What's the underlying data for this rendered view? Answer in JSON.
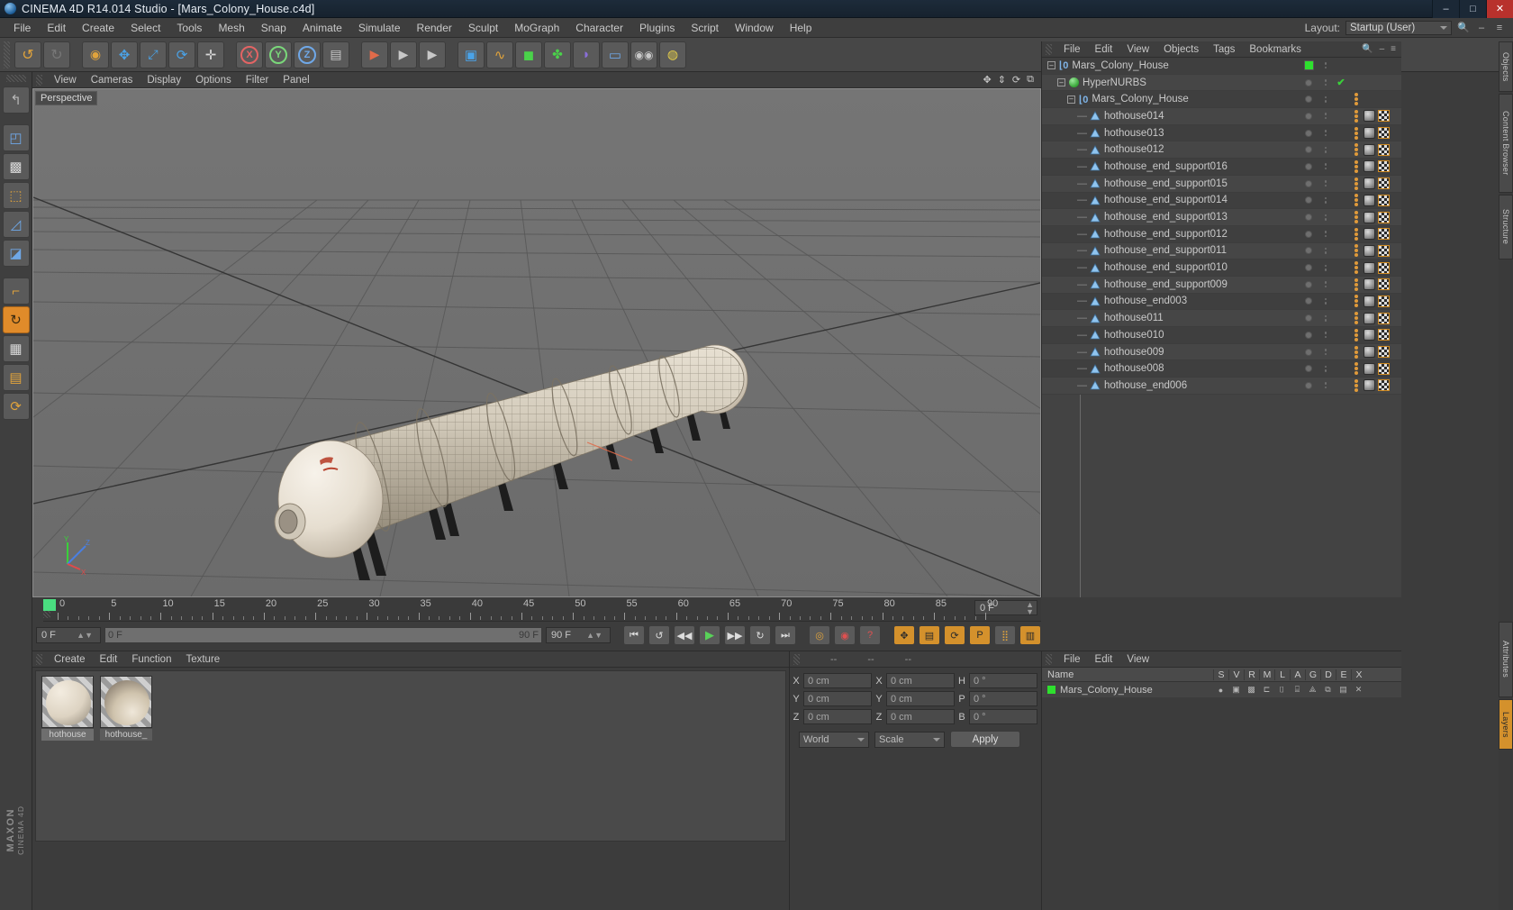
{
  "window": {
    "title": "CINEMA 4D R14.014 Studio - [Mars_Colony_House.c4d]",
    "minimize": "–",
    "maximize": "□",
    "close": "✕"
  },
  "menubar": {
    "items": [
      "File",
      "Edit",
      "Create",
      "Select",
      "Tools",
      "Mesh",
      "Snap",
      "Animate",
      "Simulate",
      "Render",
      "Sculpt",
      "MoGraph",
      "Character",
      "Plugins",
      "Script",
      "Window",
      "Help"
    ],
    "layout_label": "Layout:",
    "layout_value": "Startup (User)",
    "search_icon": "search-icon",
    "minus_icon": "–",
    "menu_icon": "≡"
  },
  "toolbar": {
    "buttons": [
      {
        "name": "undo-button",
        "glyph": "↺"
      },
      {
        "name": "redo-button",
        "glyph": "↻"
      },
      {
        "name": "live-selection-button",
        "glyph": "◉"
      },
      {
        "name": "move-button",
        "glyph": "✥"
      },
      {
        "name": "scale-button",
        "glyph": "⤡"
      },
      {
        "name": "rotate-button",
        "glyph": "⟳"
      },
      {
        "name": "world-object-axis-button",
        "glyph": "✛"
      },
      {
        "name": "lock-x-axis-button",
        "glyph": "X"
      },
      {
        "name": "lock-y-axis-button",
        "glyph": "Y"
      },
      {
        "name": "lock-z-axis-button",
        "glyph": "Z"
      },
      {
        "name": "world-coordinates-button",
        "glyph": "⬓"
      },
      {
        "name": "render-view-button",
        "glyph": "▶"
      },
      {
        "name": "render-region-button",
        "glyph": "▶"
      },
      {
        "name": "render-settings-button",
        "glyph": "▶"
      },
      {
        "name": "cube-primitive-button",
        "glyph": "▣"
      },
      {
        "name": "spline-button",
        "glyph": "〜"
      },
      {
        "name": "hypernurbs-button",
        "glyph": "◼"
      },
      {
        "name": "array-button",
        "glyph": "✤"
      },
      {
        "name": "bend-deformer-button",
        "glyph": "◗"
      },
      {
        "name": "floor-button",
        "glyph": "▭"
      },
      {
        "name": "camera-button",
        "glyph": "◉◉"
      },
      {
        "name": "light-button",
        "glyph": "💡"
      }
    ]
  },
  "left_palette": {
    "buttons": [
      {
        "name": "tool-undo-view-button",
        "glyph": "↰"
      },
      {
        "name": "tool-model-mode-button",
        "glyph": "◰"
      },
      {
        "name": "tool-texture-mode-button",
        "glyph": "▩"
      },
      {
        "name": "tool-points-mode-button",
        "glyph": "⬚"
      },
      {
        "name": "tool-edges-mode-button",
        "glyph": "◿"
      },
      {
        "name": "tool-polygons-mode-button",
        "glyph": "◪"
      },
      {
        "name": "tool-axis-mode-button",
        "glyph": "⌐"
      },
      {
        "name": "tool-enable-axis-button",
        "glyph": "↻"
      },
      {
        "name": "tool-viewport-solo-button",
        "glyph": "▦"
      },
      {
        "name": "tool-lock-button",
        "glyph": "🔒"
      },
      {
        "name": "tool-quantize-button",
        "glyph": "⟳"
      }
    ],
    "brand": "MAXON",
    "brand_sub": "CINEMA 4D"
  },
  "viewport": {
    "menus": [
      "View",
      "Cameras",
      "Display",
      "Options",
      "Filter",
      "Panel"
    ],
    "label": "Perspective",
    "axis": {
      "x": "X",
      "y": "Y",
      "z": "Z"
    },
    "corner_icons": [
      "pan-icon",
      "dolly-icon",
      "rotate-icon",
      "maximize-icon"
    ]
  },
  "object_manager": {
    "menus": [
      "File",
      "Edit",
      "View",
      "Objects",
      "Tags",
      "Bookmarks"
    ],
    "right_icons": [
      "search-icon",
      "minimize-icon",
      "menu-icon"
    ],
    "rows": [
      {
        "label": "Mars_Colony_House",
        "indent": 0,
        "icon": "null-object-icon",
        "expander": "–",
        "visdot": "green",
        "tags": []
      },
      {
        "label": "HyperNURBS",
        "indent": 1,
        "icon": "hypernurbs-icon",
        "expander": "–",
        "visdot": "gray",
        "check": "✔",
        "tags": []
      },
      {
        "label": "Mars_Colony_House",
        "indent": 2,
        "icon": "null-object-icon",
        "expander": "–",
        "visdot": "gray",
        "tags": []
      },
      {
        "label": "hothouse014",
        "indent": 3,
        "icon": "polygon-object-icon",
        "expander": "",
        "visdot": "gray",
        "tags": [
          "material",
          "texture"
        ]
      },
      {
        "label": "hothouse013",
        "indent": 3,
        "icon": "polygon-object-icon",
        "expander": "",
        "visdot": "gray",
        "tags": [
          "material",
          "texture"
        ]
      },
      {
        "label": "hothouse012",
        "indent": 3,
        "icon": "polygon-object-icon",
        "expander": "",
        "visdot": "gray",
        "tags": [
          "material",
          "texture"
        ]
      },
      {
        "label": "hothouse_end_support016",
        "indent": 3,
        "icon": "polygon-object-icon",
        "expander": "",
        "visdot": "gray",
        "tags": [
          "material",
          "texture"
        ]
      },
      {
        "label": "hothouse_end_support015",
        "indent": 3,
        "icon": "polygon-object-icon",
        "expander": "",
        "visdot": "gray",
        "tags": [
          "material",
          "texture"
        ]
      },
      {
        "label": "hothouse_end_support014",
        "indent": 3,
        "icon": "polygon-object-icon",
        "expander": "",
        "visdot": "gray",
        "tags": [
          "material",
          "texture"
        ]
      },
      {
        "label": "hothouse_end_support013",
        "indent": 3,
        "icon": "polygon-object-icon",
        "expander": "",
        "visdot": "gray",
        "tags": [
          "material",
          "texture"
        ]
      },
      {
        "label": "hothouse_end_support012",
        "indent": 3,
        "icon": "polygon-object-icon",
        "expander": "",
        "visdot": "gray",
        "tags": [
          "material",
          "texture"
        ]
      },
      {
        "label": "hothouse_end_support011",
        "indent": 3,
        "icon": "polygon-object-icon",
        "expander": "",
        "visdot": "gray",
        "tags": [
          "material",
          "texture"
        ]
      },
      {
        "label": "hothouse_end_support010",
        "indent": 3,
        "icon": "polygon-object-icon",
        "expander": "",
        "visdot": "gray",
        "tags": [
          "material",
          "texture"
        ]
      },
      {
        "label": "hothouse_end_support009",
        "indent": 3,
        "icon": "polygon-object-icon",
        "expander": "",
        "visdot": "gray",
        "tags": [
          "material",
          "texture"
        ]
      },
      {
        "label": "hothouse_end003",
        "indent": 3,
        "icon": "polygon-object-icon",
        "expander": "",
        "visdot": "gray",
        "tags": [
          "material",
          "texture"
        ]
      },
      {
        "label": "hothouse011",
        "indent": 3,
        "icon": "polygon-object-icon",
        "expander": "",
        "visdot": "gray",
        "tags": [
          "material",
          "texture"
        ]
      },
      {
        "label": "hothouse010",
        "indent": 3,
        "icon": "polygon-object-icon",
        "expander": "",
        "visdot": "gray",
        "tags": [
          "material",
          "texture"
        ]
      },
      {
        "label": "hothouse009",
        "indent": 3,
        "icon": "polygon-object-icon",
        "expander": "",
        "visdot": "gray",
        "tags": [
          "material",
          "texture"
        ]
      },
      {
        "label": "hothouse008",
        "indent": 3,
        "icon": "polygon-object-icon",
        "expander": "",
        "visdot": "gray",
        "tags": [
          "material",
          "texture"
        ]
      },
      {
        "label": "hothouse_end006",
        "indent": 3,
        "icon": "polygon-object-icon",
        "expander": "",
        "visdot": "gray",
        "tags": [
          "material",
          "texture"
        ]
      }
    ]
  },
  "right_dock": {
    "tabs": [
      "Objects",
      "Content Browser",
      "Structure",
      "Attributes",
      "Layers"
    ],
    "active_tab": "Layers"
  },
  "timeline": {
    "ticks": [
      0,
      5,
      10,
      15,
      20,
      25,
      30,
      35,
      40,
      45,
      50,
      55,
      60,
      65,
      70,
      75,
      80,
      85,
      90
    ],
    "current_frame_box": "0 F",
    "current_frame_field": "0 F",
    "range_start": "0 F",
    "range_end": "90 F",
    "end_frame_field": "90 F",
    "transport": [
      {
        "name": "go-to-start-button",
        "glyph": "⏮"
      },
      {
        "name": "step-back-keyframe-button",
        "glyph": "◁"
      },
      {
        "name": "step-back-frame-button",
        "glyph": "◀◀"
      },
      {
        "name": "play-button",
        "glyph": "▶"
      },
      {
        "name": "step-forward-frame-button",
        "glyph": "▶▶"
      },
      {
        "name": "step-forward-keyframe-button",
        "glyph": "▷"
      },
      {
        "name": "go-to-end-button",
        "glyph": "⏭"
      },
      {
        "name": "autokeying-button",
        "glyph": "◎"
      },
      {
        "name": "record-active-objects-button",
        "glyph": "◉"
      },
      {
        "name": "keyframe-selection-button",
        "glyph": "?"
      },
      {
        "name": "position-key-button",
        "glyph": "✥"
      },
      {
        "name": "scale-key-button",
        "glyph": "⬓"
      },
      {
        "name": "rotation-key-button",
        "glyph": "⟳"
      },
      {
        "name": "parameter-key-button",
        "glyph": "P"
      },
      {
        "name": "point-level-animation-button",
        "glyph": "⣿"
      },
      {
        "name": "timeline-button",
        "glyph": "▥"
      }
    ]
  },
  "material_manager": {
    "menus": [
      "Create",
      "Edit",
      "Function",
      "Texture"
    ],
    "materials": [
      {
        "label": "hothouse",
        "name": "material-hothouse-1",
        "selected": true
      },
      {
        "label": "hothouse_",
        "name": "material-hothouse-2",
        "selected": false
      }
    ]
  },
  "coordinates_manager": {
    "headers": [
      "--",
      "--",
      "--"
    ],
    "rows": [
      {
        "k1": "X",
        "v1": "0 cm",
        "k2": "X",
        "v2": "0 cm",
        "k3": "H",
        "v3": "0 °"
      },
      {
        "k1": "Y",
        "v1": "0 cm",
        "k2": "Y",
        "v2": "0 cm",
        "k3": "P",
        "v3": "0 °"
      },
      {
        "k1": "Z",
        "v1": "0 cm",
        "k2": "Z",
        "v2": "0 cm",
        "k3": "B",
        "v3": "0 °"
      }
    ],
    "coord_system": "World",
    "size_mode": "Scale",
    "apply_label": "Apply"
  },
  "layer_manager": {
    "menus": [
      "File",
      "Edit",
      "View"
    ],
    "columns": [
      "Name",
      "S",
      "V",
      "R",
      "M",
      "L",
      "A",
      "G",
      "D",
      "E",
      "X"
    ],
    "rows": [
      {
        "label": "Mars_Colony_House",
        "color": "#2ee02e",
        "cells": [
          "●",
          "▣",
          "▩",
          "⊏",
          "🔒",
          "⌸",
          "⟁",
          "⧉",
          "▤",
          "✕"
        ]
      }
    ]
  },
  "colors": {
    "accent_orange": "#d4912c",
    "title_blue": "#16222e",
    "panel_gray": "#3c3c3c",
    "viewport_gray": "#6f6f6f",
    "selection_green": "#2ee02e",
    "close_red": "#b8312c"
  }
}
